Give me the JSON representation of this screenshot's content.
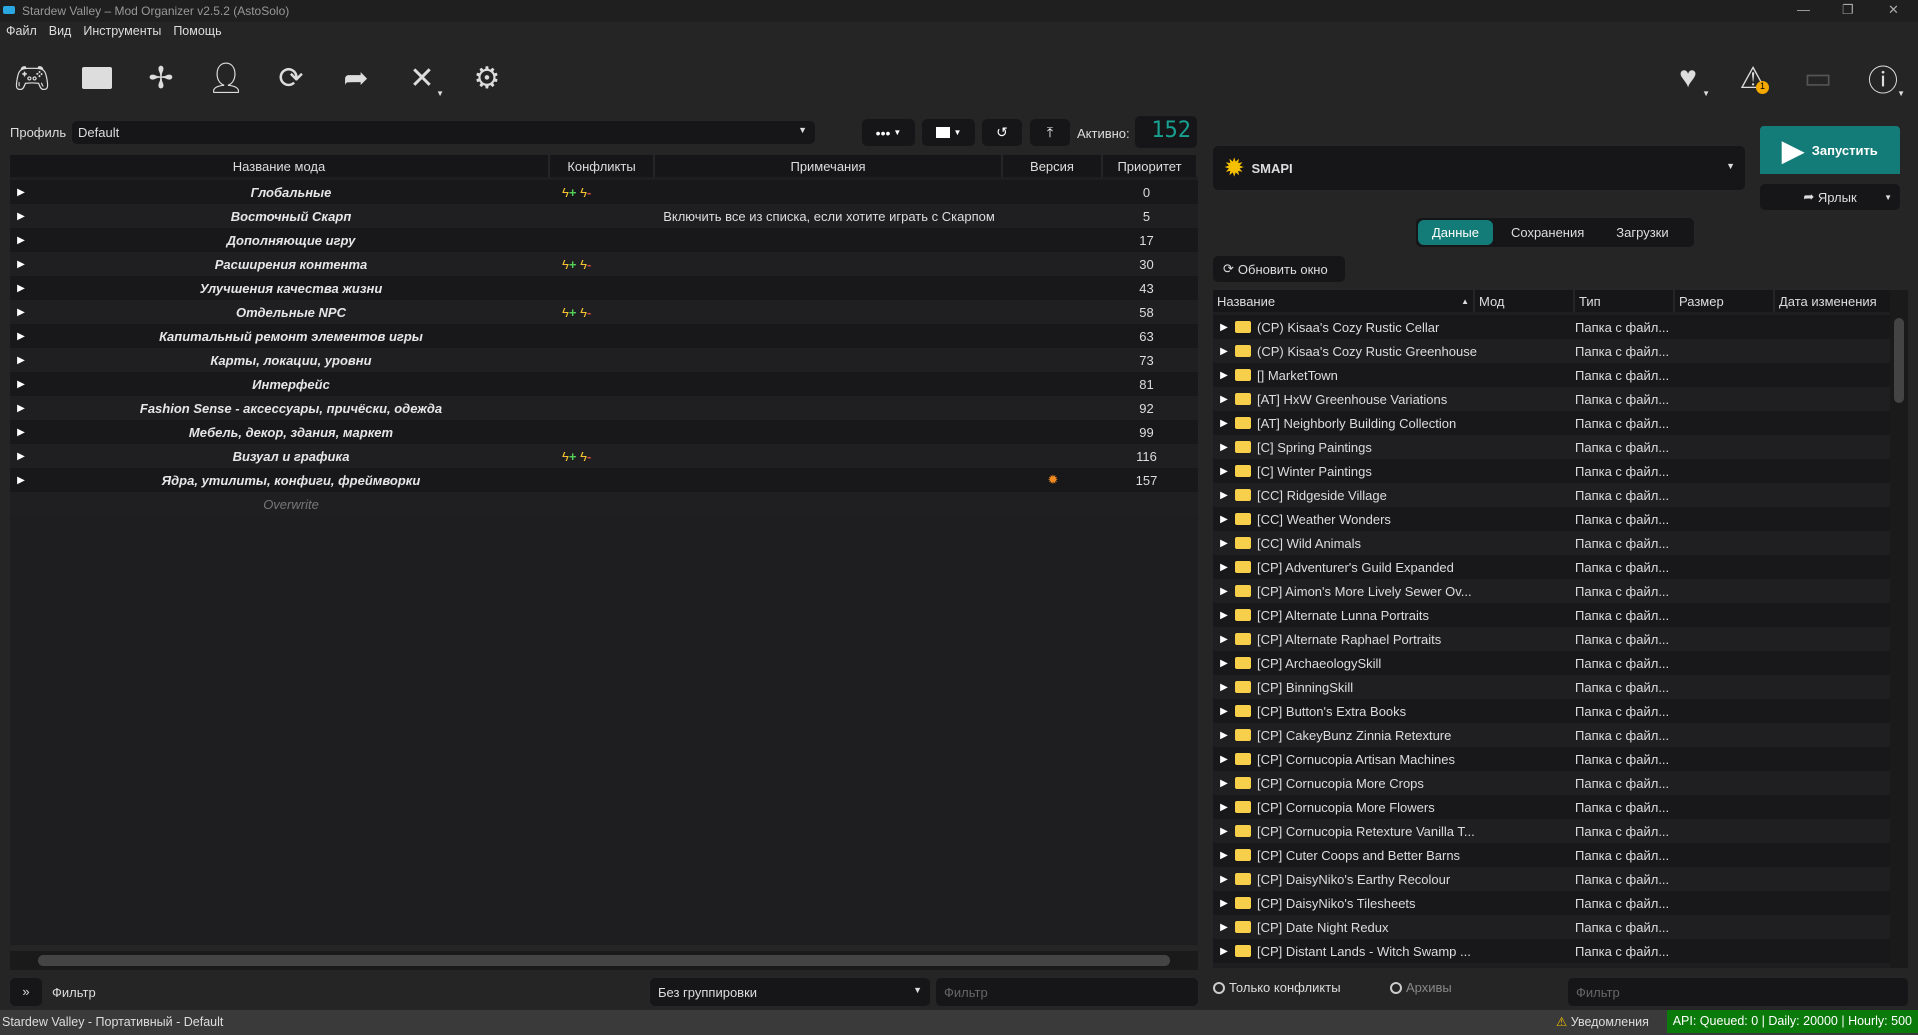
{
  "window": {
    "title": "Stardew Valley – Mod Organizer v2.5.2 (AstoSolo)"
  },
  "menu": [
    "Файл",
    "Вид",
    "Инструменты",
    "Помощь"
  ],
  "profile": {
    "label": "Профиль",
    "value": "Default"
  },
  "active": {
    "label": "Активно:",
    "count": "152"
  },
  "mod_table": {
    "headers": [
      "Название мода",
      "Конфликты",
      "Примечания",
      "Версия",
      "Приоритет"
    ],
    "rows": [
      {
        "name": "Глобальные",
        "conflicts": true,
        "notes": "",
        "flag": false,
        "priority": "0"
      },
      {
        "name": "Восточный Скарп",
        "conflicts": false,
        "notes": "Включить все из списка, если хотите играть с Скарпом",
        "flag": false,
        "priority": "5"
      },
      {
        "name": "Дополняющие игру",
        "conflicts": false,
        "notes": "",
        "flag": false,
        "priority": "17"
      },
      {
        "name": "Расширения контента",
        "conflicts": true,
        "notes": "",
        "flag": false,
        "priority": "30"
      },
      {
        "name": "Улучшения качества жизни",
        "conflicts": false,
        "notes": "",
        "flag": false,
        "priority": "43"
      },
      {
        "name": "Отдельные NPC",
        "conflicts": true,
        "notes": "",
        "flag": false,
        "priority": "58"
      },
      {
        "name": "Капитальный ремонт элементов игры",
        "conflicts": false,
        "notes": "",
        "flag": false,
        "priority": "63"
      },
      {
        "name": "Карты, локации, уровни",
        "conflicts": false,
        "notes": "",
        "flag": false,
        "priority": "73"
      },
      {
        "name": "Интерфейс",
        "conflicts": false,
        "notes": "",
        "flag": false,
        "priority": "81"
      },
      {
        "name": "Fashion Sense - аксессуары, причёски, одежда",
        "conflicts": false,
        "notes": "",
        "flag": false,
        "priority": "92"
      },
      {
        "name": "Мебель, декор, здания, маркет",
        "conflicts": false,
        "notes": "",
        "flag": false,
        "priority": "99"
      },
      {
        "name": "Визуал и графика",
        "conflicts": true,
        "notes": "",
        "flag": false,
        "priority": "116"
      },
      {
        "name": "Ядра, утилиты, конфиги, фреймворки",
        "conflicts": false,
        "notes": "",
        "flag": true,
        "priority": "157"
      }
    ],
    "overwrite": "Overwrite"
  },
  "left_bottom": {
    "filter_label": "Фильтр",
    "grouping": "Без группировки",
    "filter_placeholder": "Фильтр"
  },
  "executable": {
    "name": "SMAPI"
  },
  "run_label": "Запустить",
  "shortcut_label": "Ярлык",
  "tabs": [
    "Данные",
    "Сохранения",
    "Загрузки"
  ],
  "refresh_label": "Обновить окно",
  "file_table": {
    "headers": [
      "Название",
      "Мод",
      "Тип",
      "Размер",
      "Дата изменения"
    ],
    "type_value": "Папка с файл...",
    "rows": [
      "(CP) Kisaa's Cozy Rustic Cellar",
      "(CP) Kisaa's Cozy Rustic Greenhouse",
      "[] MarketTown",
      "[AT] HxW Greenhouse Variations",
      "[AT] Neighborly Building Collection",
      "[C] Spring Paintings",
      "[C] Winter Paintings",
      "[CC] Ridgeside Village",
      "[CC] Weather Wonders",
      "[CC] Wild Animals",
      "[CP] Adventurer's Guild Expanded",
      "[CP] Aimon's More Lively Sewer Ov...",
      "[CP] Alternate Lunna Portraits",
      "[CP] Alternate Raphael Portraits",
      "[CP] ArchaeologySkill",
      "[CP] BinningSkill",
      "[CP] Button's Extra Books",
      "[CP] CakeyBunz Zinnia Retexture",
      "[CP] Cornucopia Artisan Machines",
      "[CP] Cornucopia More Crops",
      "[CP] Cornucopia More Flowers",
      "[CP] Cornucopia Retexture Vanilla T...",
      "[CP] Cuter Coops and Better Barns",
      "[CP] DaisyNiko's Earthy Recolour",
      "[CP] DaisyNiko's Tilesheets",
      "[CP] Date Night Redux",
      "[CP] Distant Lands - Witch Swamp ..."
    ]
  },
  "right_bottom": {
    "only_conflicts": "Только конфликты",
    "archives": "Архивы",
    "filter_placeholder": "Фильтр"
  },
  "status": {
    "text": "Stardew Valley - Портативный - Default",
    "notifications": "Уведомления",
    "api": "API: Queued: 0 | Daily: 20000 | Hourly: 500",
    "warning_badge": "1"
  },
  "colors": {
    "accent": "#137c78",
    "api_bg": "#0a7a0a"
  }
}
